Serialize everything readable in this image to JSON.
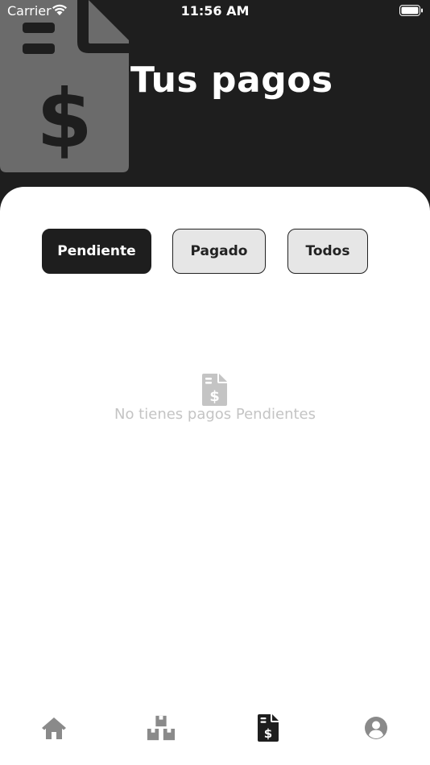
{
  "status_bar": {
    "carrier": "Carrier",
    "time": "11:56 AM"
  },
  "header": {
    "title": "Tus pagos",
    "background_icon": "invoice-dollar-icon"
  },
  "filters": {
    "pending_label": "Pendiente",
    "paid_label": "Pagado",
    "all_label": "Todos",
    "selected": "Pendiente"
  },
  "empty_state": {
    "icon": "invoice-dollar-icon",
    "message": "No tienes pagos Pendientes"
  },
  "bottom_nav": {
    "items": [
      {
        "icon": "home-icon"
      },
      {
        "icon": "boxes-icon"
      },
      {
        "icon": "invoice-dollar-icon",
        "active": true
      },
      {
        "icon": "user-circle-icon"
      }
    ]
  },
  "colors": {
    "header_bg": "#1e1e1e",
    "primary": "#1e1e1e",
    "inactive_button_bg": "#e6e6e6",
    "empty_text": "#c4c4c4",
    "nav_inactive": "#8a8a8a",
    "nav_active": "#1e1e1e"
  }
}
